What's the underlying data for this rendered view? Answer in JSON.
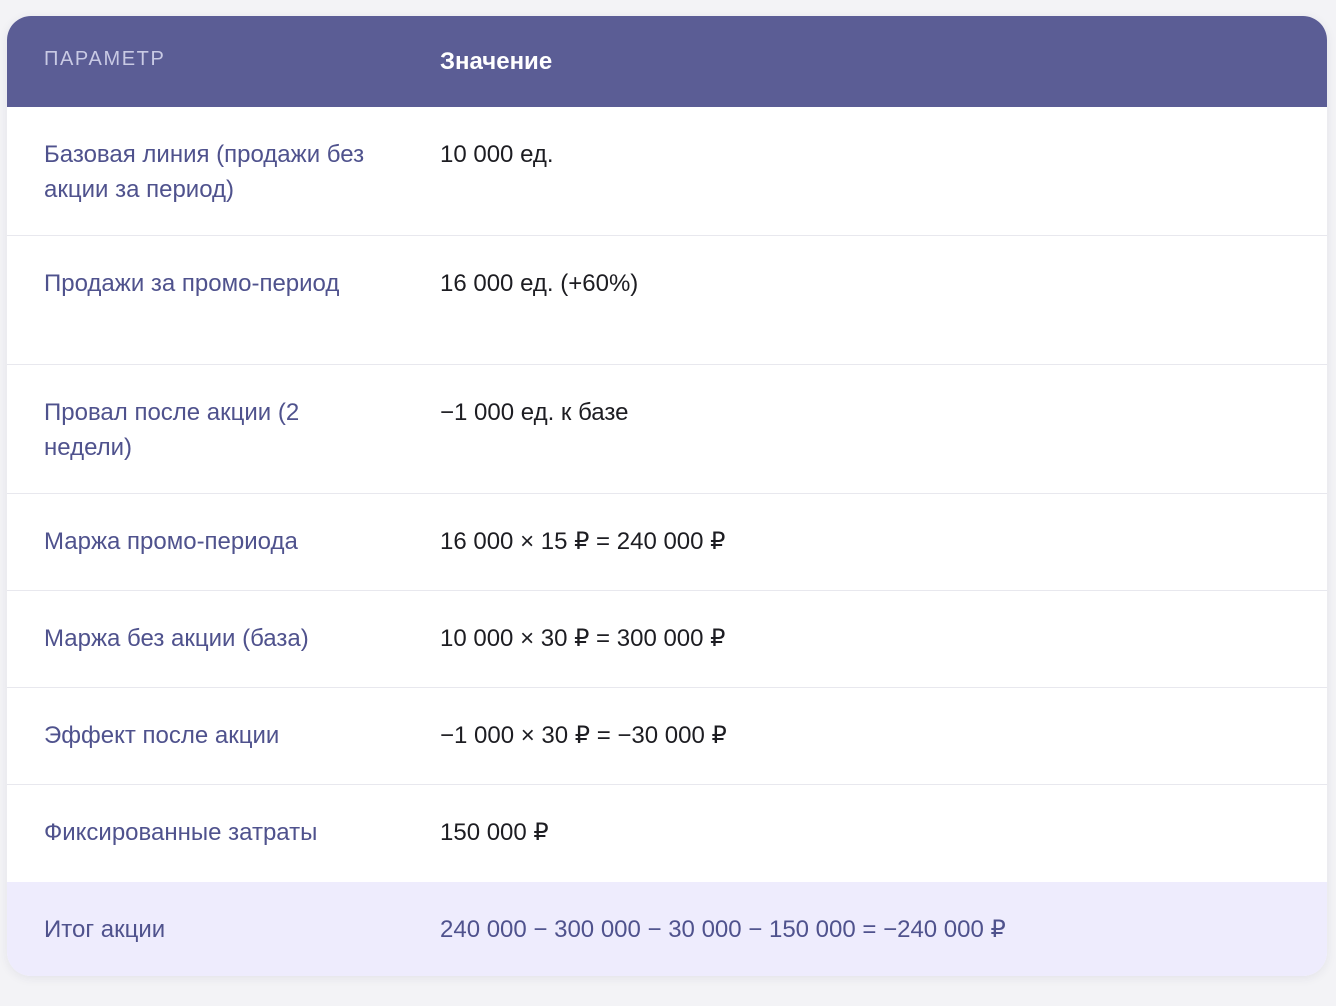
{
  "header": {
    "param_label": "ПАРАМЕТР",
    "value_label": "Значение"
  },
  "rows": [
    {
      "param": "Базовая линия (продажи без акции за период)",
      "value": "10 000 ед."
    },
    {
      "param": "Продажи за промо-период",
      "value": "16 000 ед. (+60%)"
    },
    {
      "param": "Провал после акции (2 недели)",
      "value": "−1 000 ед. к базе"
    },
    {
      "param": "Маржа промо-периода",
      "value": "16 000 × 15 ₽ = 240 000 ₽"
    },
    {
      "param": "Маржа без акции (база)",
      "value": "10 000 × 30 ₽ = 300 000 ₽"
    },
    {
      "param": "Эффект после акции",
      "value": "−1 000 × 30 ₽ = −30 000 ₽"
    },
    {
      "param": "Фиксированные затраты",
      "value": "150 000 ₽"
    }
  ],
  "total": {
    "param": "Итог акции",
    "value": "240 000 − 300 000 − 30 000 − 150 000 = −240 000 ₽"
  },
  "colors": {
    "header_bg": "#5b5d95",
    "param_text": "#4f528d",
    "total_bg": "#eeecfd"
  }
}
